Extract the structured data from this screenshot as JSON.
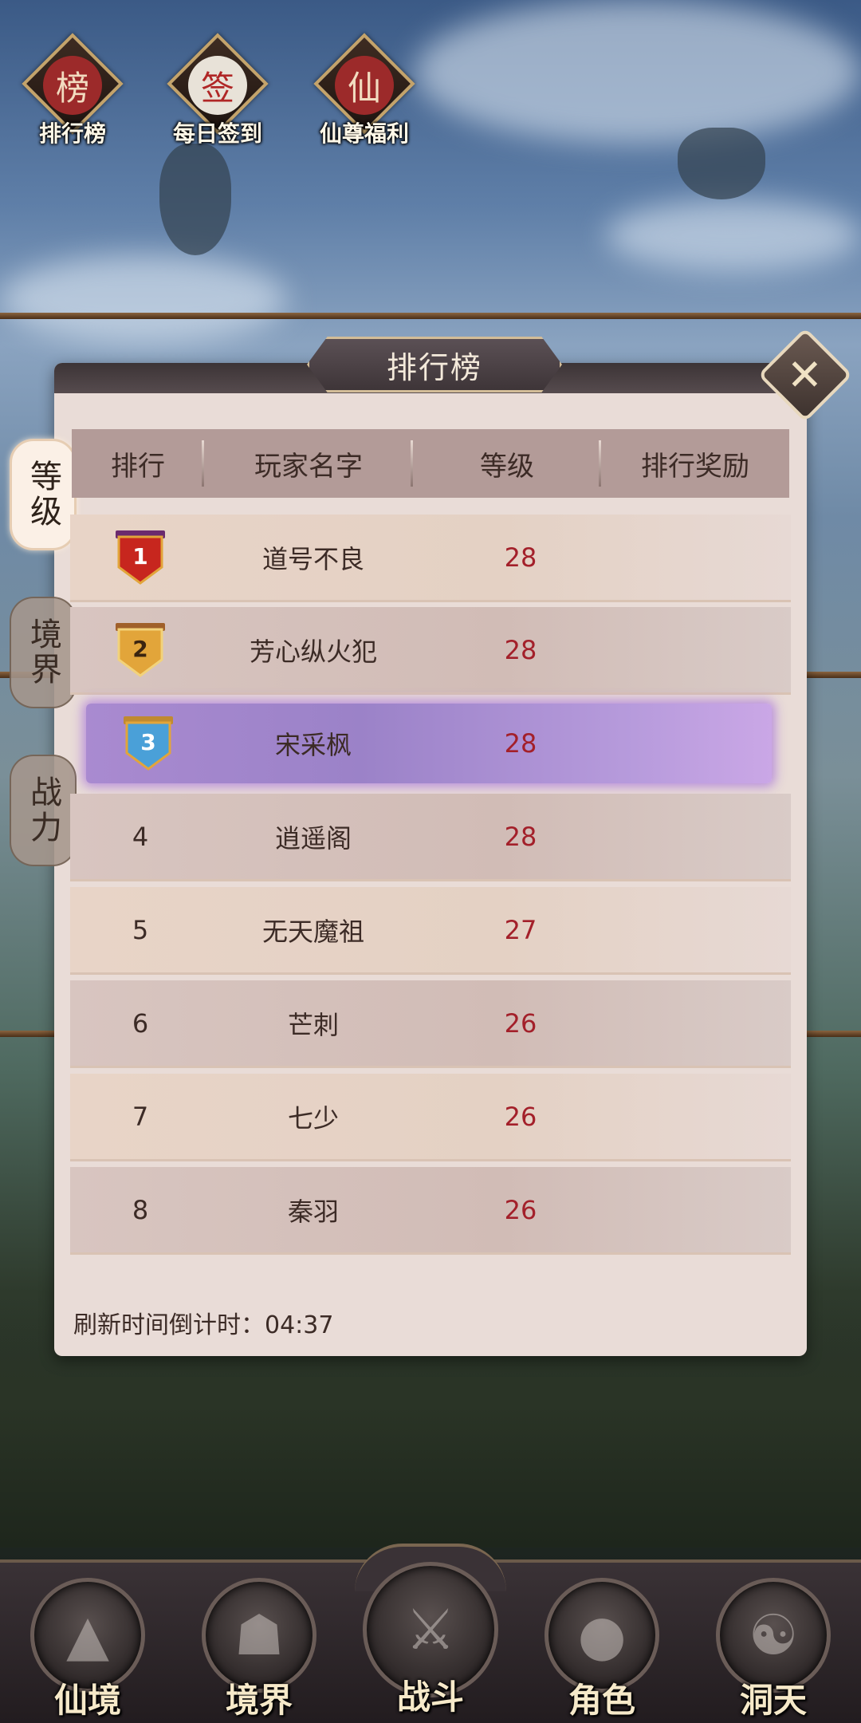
{
  "top_icons": [
    {
      "glyph": "榜",
      "label": "排行榜",
      "color": "#9c2a2a"
    },
    {
      "glyph": "签",
      "label": "每日签到",
      "color": "#e8e2d8"
    },
    {
      "glyph": "仙",
      "label": "仙尊福利",
      "color": "#9c2a2a"
    }
  ],
  "side_tabs": [
    {
      "label": "等级",
      "active": true
    },
    {
      "label": "境界",
      "active": false
    },
    {
      "label": "战力",
      "active": false
    }
  ],
  "panel": {
    "title": "排行榜",
    "close_icon": "close-icon"
  },
  "table": {
    "headers": [
      "排行",
      "玩家名字",
      "等级",
      "排行奖励"
    ],
    "rows": [
      {
        "rank": "1",
        "name": "道号不良",
        "level": "28"
      },
      {
        "rank": "2",
        "name": "芳心纵火犯",
        "level": "28"
      },
      {
        "rank": "3",
        "name": "宋采枫",
        "level": "28"
      },
      {
        "rank": "4",
        "name": "逍遥阁",
        "level": "28"
      },
      {
        "rank": "5",
        "name": "无天魔祖",
        "level": "27"
      },
      {
        "rank": "6",
        "name": "芒刺",
        "level": "26"
      },
      {
        "rank": "7",
        "name": "七少",
        "level": "26"
      },
      {
        "rank": "8",
        "name": "秦羽",
        "level": "26"
      }
    ],
    "highlighted_rank": "3"
  },
  "countdown": "刷新时间倒计时：04:37",
  "bottom_nav": [
    {
      "label": "仙境",
      "icon": "mountain-icon"
    },
    {
      "label": "境界",
      "icon": "meditation-icon"
    },
    {
      "label": "战斗",
      "icon": "crossed-swords-icon"
    },
    {
      "label": "角色",
      "icon": "character-icon"
    },
    {
      "label": "洞天",
      "icon": "triskelion-icon"
    }
  ],
  "colors": {
    "level_text": "#a3202a",
    "badge_gold": "#e2a53a",
    "badge_red": "#c7261e",
    "badge_blue": "#4aa0d8",
    "highlight": "#a98ad0"
  }
}
